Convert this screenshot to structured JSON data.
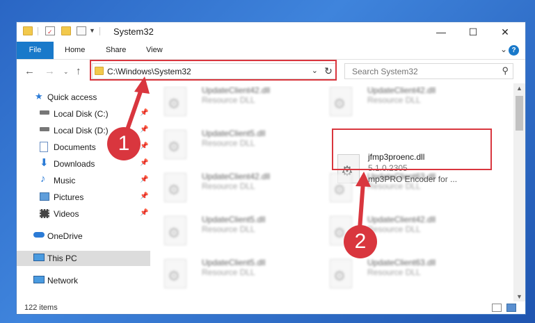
{
  "window": {
    "title": "System32",
    "minimize": "—",
    "maximize": "☐",
    "close": "✕"
  },
  "ribbon": {
    "tabs": [
      "File",
      "Home",
      "Share",
      "View"
    ],
    "help": "?"
  },
  "address": {
    "path": "C:\\Windows\\System32",
    "refresh": "↻"
  },
  "search": {
    "placeholder": "Search System32"
  },
  "sidebar": {
    "items": [
      {
        "label": "Quick access",
        "icon": "star-icon",
        "pinned": false
      },
      {
        "label": "Local Disk (C:)",
        "icon": "drive-icon",
        "pinned": true
      },
      {
        "label": "Local Disk (D:)",
        "icon": "drive-icon",
        "pinned": true
      },
      {
        "label": "Documents",
        "icon": "documents-icon",
        "pinned": true
      },
      {
        "label": "Downloads",
        "icon": "download-icon",
        "pinned": true
      },
      {
        "label": "Music",
        "icon": "music-icon",
        "pinned": true
      },
      {
        "label": "Pictures",
        "icon": "pictures-icon",
        "pinned": true
      },
      {
        "label": "Videos",
        "icon": "videos-icon",
        "pinned": true
      },
      {
        "label": "OneDrive",
        "icon": "cloud-icon",
        "pinned": false
      },
      {
        "label": "This PC",
        "icon": "computer-icon",
        "pinned": false
      },
      {
        "label": "Network",
        "icon": "network-icon",
        "pinned": false
      }
    ]
  },
  "files": {
    "left": [
      {
        "name": "UpdateClient42.dll",
        "desc": "Resource DLL"
      },
      {
        "name": "UpdateClient5.dll",
        "desc": "Resource DLL"
      },
      {
        "name": "UpdateClient42.dll",
        "desc": "Resource DLL"
      },
      {
        "name": "UpdateClient5.dll",
        "desc": "Resource DLL"
      },
      {
        "name": "UpdateClient5.dll",
        "desc": "Resource DLL"
      }
    ],
    "right": [
      {
        "name": "UpdateClient42.dll",
        "desc": "Resource DLL"
      },
      {
        "name": "UpdateClient63.dll",
        "desc": "Resource DLL"
      },
      {
        "name": "UpdateClient42.dll",
        "desc": "Resource DLL"
      },
      {
        "name": "UpdateClient63.dll",
        "desc": "Resource DLL"
      }
    ],
    "highlighted": {
      "name": "jfmp3proenc.dll",
      "version": "5.1.0.2305",
      "desc": "mp3PRO Encoder for ..."
    }
  },
  "status": {
    "count": "122 items"
  },
  "annotations": {
    "step1": "1",
    "step2": "2",
    "color": "#d9363e"
  }
}
